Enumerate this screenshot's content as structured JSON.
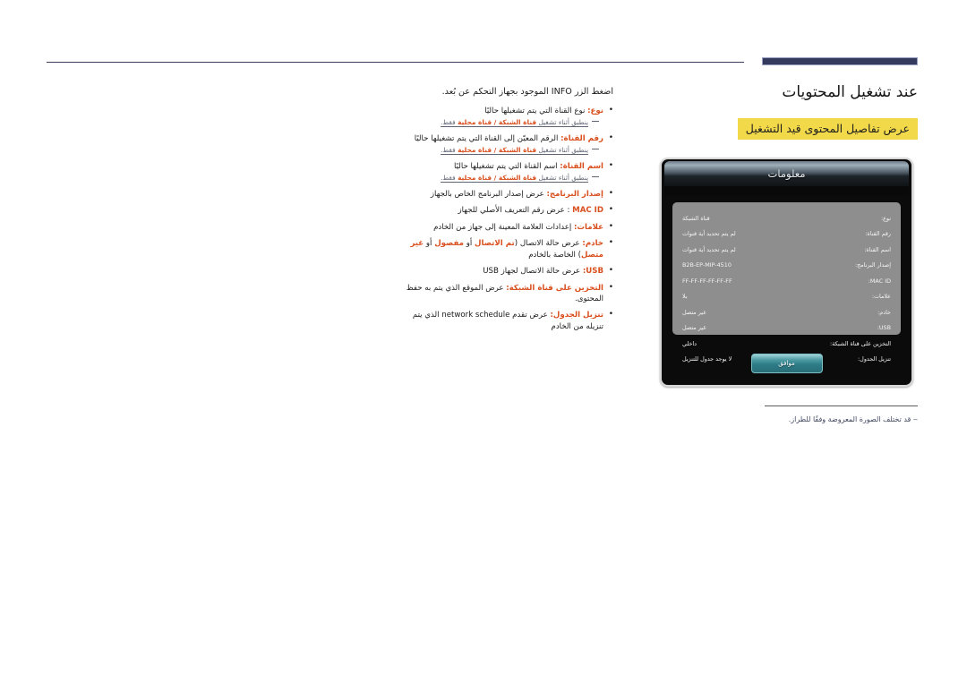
{
  "page": {
    "title": "عند تشغيل المحتويات",
    "section_heading": "عرض تفاصيل المحتوى قيد التشغيل",
    "footnote": "‒ قد تختلف الصورة المعروضة وفقًا للطراز.",
    "intro_text": "اضغط الزر INFO الموجود بجهاز التحكم عن بُعد.",
    "accent_color": "#d94f1e",
    "highlight_color": "#f2d949",
    "rule_color": "#333a5e"
  },
  "bullets": [
    {
      "term": "نوع:",
      "desc": "نوع القناة التي يتم تشغيلها حاليًا",
      "note_prefix": "ينطبق أثناء تشغيل",
      "note_terms": "قناة الشبكة / قناة محلية",
      "note_suffix": "فقط."
    },
    {
      "term": "رقم القناة:",
      "desc": "الرقم المعيّن إلى القناة التي يتم تشغيلها حاليًا",
      "note_prefix": "ينطبق أثناء تشغيل",
      "note_terms": "قناة الشبكة / قناة محلية",
      "note_suffix": "فقط."
    },
    {
      "term": "اسم القناة:",
      "desc": "اسم القناة التي يتم تشغيلها حاليًا",
      "note_prefix": "ينطبق أثناء تشغيل",
      "note_terms": "قناة الشبكة / قناة محلية",
      "note_suffix": "فقط."
    },
    {
      "term": "إصدار البرنامج:",
      "desc": "عرض إصدار البرنامج الخاص بالجهاز",
      "note_prefix": "",
      "note_terms": "",
      "note_suffix": ""
    },
    {
      "term": "MAC ID",
      "desc": ": عرض رقم التعريف الأصلي للجهاز",
      "note_prefix": "",
      "note_terms": "",
      "note_suffix": ""
    },
    {
      "term": "علامات:",
      "desc": "إعدادات العلامة المعينة إلى جهاز من الخادم",
      "note_prefix": "",
      "note_terms": "",
      "note_suffix": ""
    },
    {
      "term": "خادم:",
      "desc": "عرض حالة الاتصال",
      "note_prefix": "",
      "note_terms": "",
      "note_suffix": ""
    },
    {
      "term": "USB:",
      "desc": "عرض حالة الاتصال لجهاز USB",
      "note_prefix": "",
      "note_terms": "",
      "note_suffix": ""
    },
    {
      "term": "التخزين على قناة الشبكة:",
      "desc": "عرض الموقع الذي يتم به حفظ المحتوى.",
      "note_prefix": "",
      "note_terms": "",
      "note_suffix": ""
    },
    {
      "term": "تنزيل الجدول:",
      "desc": "عرض تقدم network schedule الذي يتم تنزيله من الخادم",
      "note_prefix": "",
      "note_terms": "",
      "note_suffix": ""
    }
  ],
  "bullet_server_states": {
    "connected": "تم الاتصال",
    "disconnected": "مفصول",
    "not_connected": "غير متصل"
  },
  "dialog": {
    "title": "معلومات",
    "ok_label": "موافق",
    "rows": [
      {
        "label": "نوع:",
        "value": "قناة الشبكة",
        "rtl": true
      },
      {
        "label": "رقم القناة:",
        "value": "لم يتم تحديد أية قنوات",
        "rtl": true
      },
      {
        "label": "اسم القناة:",
        "value": "لم يتم تحديد أية قنوات",
        "rtl": true
      },
      {
        "label": "إصدار البرنامج:",
        "value": "B2B-EP-MIP-4510",
        "rtl": false
      },
      {
        "label": "MAC ID:",
        "value": "FF-FF-FF-FF-FF-FF",
        "rtl": false
      },
      {
        "label": "علامات:",
        "value": "بلا",
        "rtl": true
      },
      {
        "label": "خادم:",
        "value": "غير متصل",
        "rtl": true
      },
      {
        "label": "USB:",
        "value": "غير متصل",
        "rtl": true
      },
      {
        "label": "التخزين على قناة الشبكة:",
        "value": "داخلي",
        "rtl": true
      },
      {
        "label": "تنزيل الجدول:",
        "value": "لا يوجد جدول للتنزيل",
        "rtl": true
      }
    ]
  }
}
